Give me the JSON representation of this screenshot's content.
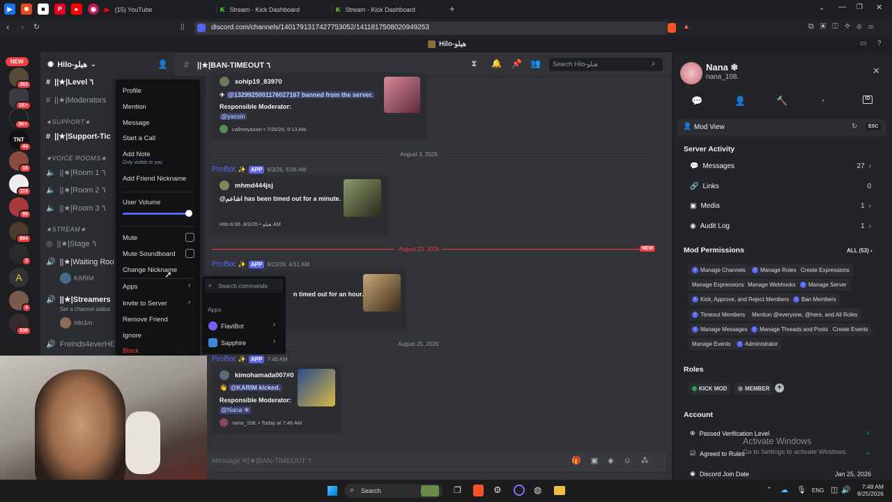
{
  "browser": {
    "tabs": [
      {
        "label": "(15) YouTube"
      },
      {
        "label": "Stream - Kick Dashboard"
      },
      {
        "label": "Stream - Kick Dashboard"
      }
    ],
    "url": "discord.com/channels/1401791317427753052/1411817508020949253",
    "page_title": "Hilo-هيلو"
  },
  "server": {
    "name": "Hilo-هيلو",
    "new_badge": "NEW",
    "badges": [
      "363",
      "1K+",
      "2K+",
      "44",
      "16",
      "119",
      "99",
      "804",
      "3",
      "4",
      "536"
    ]
  },
  "channels": {
    "items": [
      {
        "label": "||★|Level ٦"
      },
      {
        "label": "||★|Moderators"
      },
      {
        "label": "★SUPPORT★"
      },
      {
        "label": "||★|Support-Tic"
      },
      {
        "label": "★VOICE ROOMS★"
      },
      {
        "label": "||★|Room 1 ٦"
      },
      {
        "label": "||★|Room 2 ٦"
      },
      {
        "label": "||★|Room 3 ٦"
      },
      {
        "label": "★STREAM★"
      },
      {
        "label": "||★|Stage ٦"
      },
      {
        "label": "||★|Waiting Roo"
      },
      {
        "label": "KARIM"
      },
      {
        "label": "||★|Streamers"
      },
      {
        "label": "Set a channel status"
      },
      {
        "label": "hilo1m"
      },
      {
        "label": "Freinds4everHEL"
      }
    ]
  },
  "chat": {
    "channel_name": "||★|BAN-TIMEOUT ٦",
    "search_placeholder": "Search Hilo-هيلو",
    "composer_placeholder": "Message #||★|BAN-TIMEOUT ٦",
    "messages": [
      {
        "user": "sohip19_83970",
        "line1": "@1329925001176027167 banned from the server.",
        "mod_label": "Responsible Moderator:",
        "mod": "@yassin",
        "footer": "callmeyassin • 7/26/26, 9:13 AM"
      },
      {
        "date": "August 3, 2026"
      },
      {
        "author": "ProBot",
        "app": "APP",
        "time": "8/3/26, 6:06 AM",
        "user": "mhmd444jsj",
        "line1": "@اشاعم has been timed out for a minute.",
        "footer": "Hilo-6:06 ,8/3/26 • هيلو AM"
      },
      {
        "date": "August 23, 2026",
        "new": "NEW"
      },
      {
        "author": "ProBot",
        "app": "APP",
        "time": "8/23/26, 4:51 AM",
        "line1": "n timed out for an hour."
      },
      {
        "date": "August 25, 2026"
      },
      {
        "author": "ProBot",
        "app": "APP",
        "time": "7:46 AM",
        "user": "kimohamada007#0",
        "line1": "@KARIM kicked.",
        "mod_label": "Responsible Moderator:",
        "mod": "@Nana ❄",
        "footer": "nana_108. • Today at 7:46 AM"
      }
    ]
  },
  "context_menu": {
    "items": [
      "Profile",
      "Mention",
      "Message",
      "Start a Call",
      "Add Note",
      "Add Friend Nickname",
      "User Volume",
      "Mute",
      "Mute Soundboard",
      "Change Nickname",
      "Apps",
      "Invite to Server",
      "Remove Friend",
      "Ignore",
      "Block"
    ],
    "note_hint": "Only visible to you",
    "volume": 0.95
  },
  "apps_submenu": {
    "search_placeholder": "Search commands",
    "section": "Apps",
    "items": [
      "FlaviBot",
      "Sapphire"
    ]
  },
  "profile": {
    "display_name": "Nana ❄",
    "username": "nana_108.",
    "mod_view": "Mod View",
    "esc": "ESC",
    "server_activity": "Server Activity",
    "activity": [
      {
        "label": "Messages",
        "value": "27"
      },
      {
        "label": "Links",
        "value": "0"
      },
      {
        "label": "Media",
        "value": "1"
      },
      {
        "label": "Audit Log",
        "value": "1"
      }
    ],
    "mod_permissions": "Mod Permissions",
    "all_count": "ALL (53)",
    "permissions": [
      "Manage Channels",
      "Manage Roles",
      "Create Expressions",
      "Manage Expressions",
      "Manage Webhooks",
      "Manage Server",
      "Kick, Approve, and Reject Members",
      "Ban Members",
      "Timeout Members",
      "Mention @everyone, @here, and All Roles",
      "Manage Messages",
      "Manage Threads and Posts",
      "Create Events",
      "Manage Events",
      "Administrator"
    ],
    "roles_title": "Roles",
    "roles": [
      "KICK MOD",
      "MEMBER"
    ],
    "account_title": "Account",
    "account": [
      {
        "label": "Passed Verification Level"
      },
      {
        "label": "Agreed to Rules"
      },
      {
        "label": "Discord Join Date",
        "value": "Jan 25, 2026"
      }
    ]
  },
  "watermark": {
    "line1": "Activate Windows",
    "line2": "Go to Settings to activate Windows."
  },
  "taskbar": {
    "search": "Search",
    "lang": "ENG",
    "time": "7:48 AM",
    "date": "8/25/2026"
  }
}
